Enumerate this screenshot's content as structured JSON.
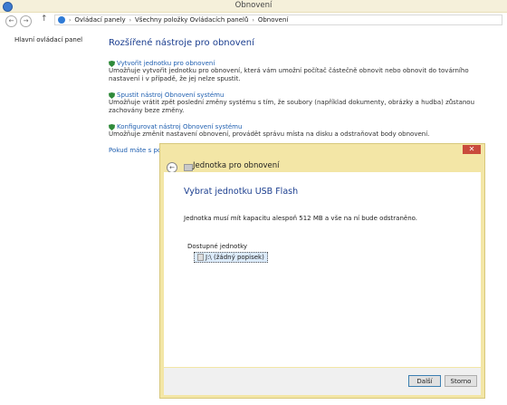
{
  "window": {
    "title": "Obnovení"
  },
  "breadcrumbs": [
    "Ovládací panely",
    "Všechny položky Ovládacích panelů",
    "Obnovení"
  ],
  "sidebar": {
    "home_link": "Hlavní ovládací panel"
  },
  "main": {
    "heading": "Rozšířené nástroje pro obnovení",
    "tools": [
      {
        "link": "Vytvořit jednotku pro obnovení",
        "desc": "Umožňuje vytvořit jednotku pro obnovení, která vám umožní počítač částečně obnovit nebo obnovit do továrního nastavení i v případě, že jej nelze spustit."
      },
      {
        "link": "Spustit nástroj Obnovení systému",
        "desc": "Umožňuje vrátit zpět poslední změny systému s tím, že soubory (například dokumenty, obrázky a hudba) zůstanou zachovány beze změny."
      },
      {
        "link": "Konfigurovat nástroj Obnovení systému",
        "desc": "Umožňuje změnit nastavení obnovení, provádět správu místa na disku a odstraňovat body obnovení."
      }
    ],
    "hint_link": "Pokud máte s počítá"
  },
  "dialog": {
    "close": "✕",
    "title": "Jednotka pro obnovení",
    "heading": "Vybrat jednotku USB Flash",
    "text": "Jednotka musí mít kapacitu alespoň 512 MB a vše na ní bude odstraněno.",
    "drives_label": "Dostupné jednotky",
    "drive_item": "J:\\ (žádný popisek)",
    "next_label": "Další",
    "cancel_label": "Storno"
  },
  "colors": {
    "accent": "#1b3e8f",
    "link": "#1f5fb0",
    "dialog_frame": "#f3e6a6",
    "close_button": "#c94b3c"
  },
  "icons": {
    "back": "back-arrow-icon",
    "shield": "shield-icon",
    "drive": "drive-icon"
  }
}
